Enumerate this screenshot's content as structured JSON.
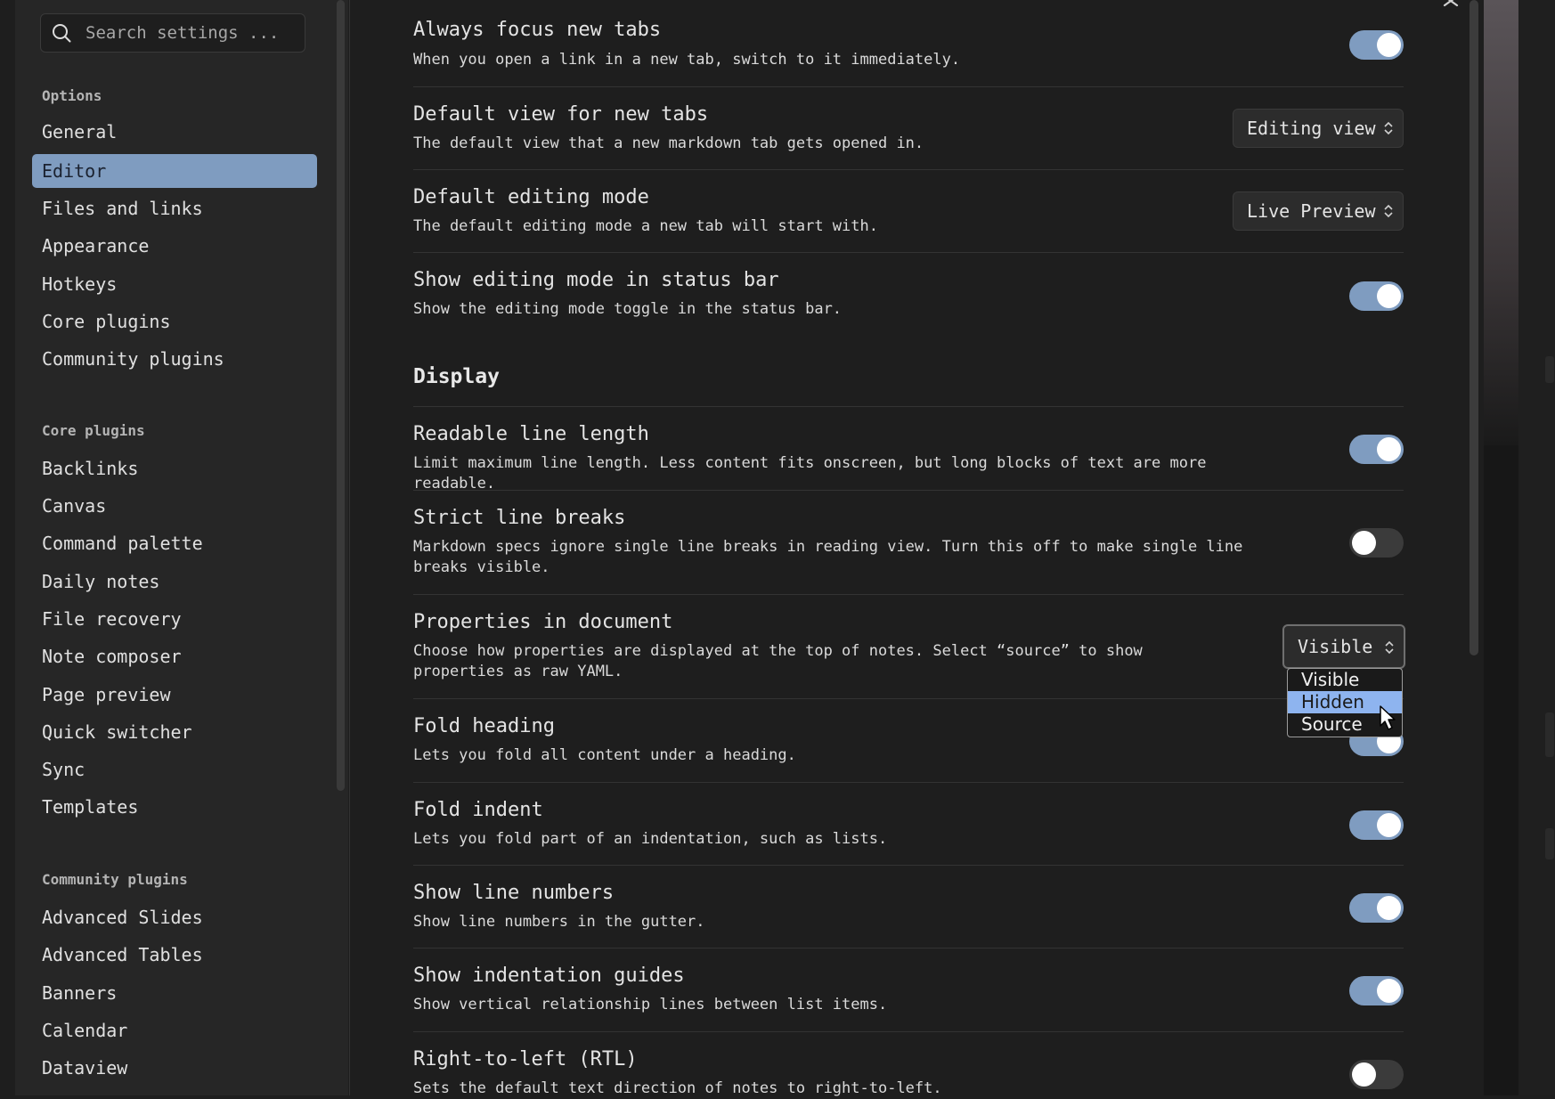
{
  "search": {
    "placeholder": "Search settings ..."
  },
  "sidebar": {
    "options_title": "Options",
    "options": [
      "General",
      "Editor",
      "Files and links",
      "Appearance",
      "Hotkeys",
      "Core plugins",
      "Community plugins"
    ],
    "core_title": "Core plugins",
    "core": [
      "Backlinks",
      "Canvas",
      "Command palette",
      "Daily notes",
      "File recovery",
      "Note composer",
      "Page preview",
      "Quick switcher",
      "Sync",
      "Templates"
    ],
    "community_title": "Community plugins",
    "community": [
      "Advanced Slides",
      "Advanced Tables",
      "Banners",
      "Calendar",
      "Dataview"
    ]
  },
  "settings": [
    {
      "name": "Always focus new tabs",
      "desc": "When you open a link in a new tab, switch to it immediately.",
      "control": "toggle",
      "on": true
    },
    {
      "name": "Default view for new tabs",
      "desc": "The default view that a new markdown tab gets opened in.",
      "control": "dropdown",
      "value": "Editing view"
    },
    {
      "name": "Default editing mode",
      "desc": "The default editing mode a new tab will start with.",
      "control": "dropdown",
      "value": "Live Preview"
    },
    {
      "name": "Show editing mode in status bar",
      "desc": "Show the editing mode toggle in the status bar.",
      "control": "toggle",
      "on": true
    },
    {
      "name": "Readable line length",
      "desc": "Limit maximum line length. Less content fits onscreen, but long blocks of text are more readable.",
      "control": "toggle",
      "on": true
    },
    {
      "name": "Strict line breaks",
      "desc": "Markdown specs ignore single line breaks in reading view. Turn this off to make single line breaks visible.",
      "control": "toggle",
      "on": false
    },
    {
      "name": "Properties in document",
      "desc": "Choose how properties are displayed at the top of notes. Select “source” to show properties as raw YAML.",
      "control": "dropdown",
      "value": "Visible"
    },
    {
      "name": "Fold heading",
      "desc": "Lets you fold all content under a heading.",
      "control": "toggle",
      "on": true
    },
    {
      "name": "Fold indent",
      "desc": "Lets you fold part of an indentation, such as lists.",
      "control": "toggle",
      "on": true
    },
    {
      "name": "Show line numbers",
      "desc": "Show line numbers in the gutter.",
      "control": "toggle",
      "on": true
    },
    {
      "name": "Show indentation guides",
      "desc": "Show vertical relationship lines between list items.",
      "control": "toggle",
      "on": true
    },
    {
      "name": "Right-to-left (RTL)",
      "desc": "Sets the default text direction of notes to right-to-left.",
      "control": "toggle",
      "on": false
    }
  ],
  "display_heading": "Display",
  "properties_dropdown": {
    "options": [
      "Visible",
      "Hidden",
      "Source"
    ],
    "highlighted": "Hidden"
  },
  "colors": {
    "accent": "#7f9cc0",
    "highlight": "#8eb4ef",
    "background": "#1e1e1e",
    "sidebar": "#262626"
  }
}
